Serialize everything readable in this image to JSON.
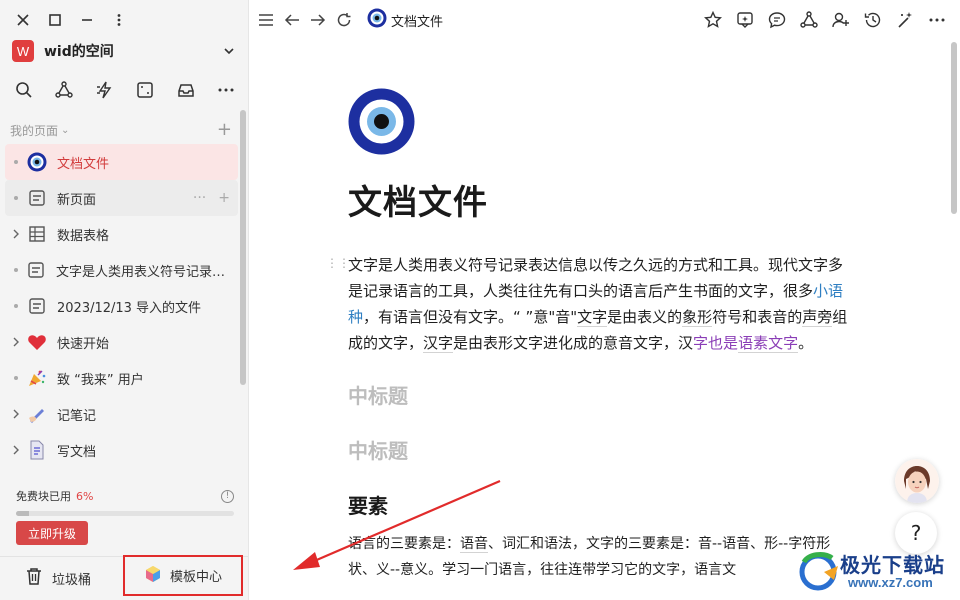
{
  "space": {
    "avatar_letter": "W",
    "name": "wid的空间"
  },
  "sidebar": {
    "section_label": "我的页面",
    "items": [
      {
        "label": "文档文件",
        "icon": "evil-eye-icon"
      },
      {
        "label": "新页面",
        "icon": "page-icon"
      },
      {
        "label": "数据表格",
        "icon": "table-icon"
      },
      {
        "label": "文字是人类用表义符号记录表达信息以传之久远的方式和工具",
        "icon": "page-icon"
      },
      {
        "label": "2023/12/13 导入的文件",
        "icon": "page-icon"
      },
      {
        "label": "快速开始",
        "icon": "heart-icon"
      },
      {
        "label": "致 “我来” 用户",
        "icon": "party-popper-icon"
      },
      {
        "label": "记笔记",
        "icon": "writing-hand-icon"
      },
      {
        "label": "写文档",
        "icon": "document-icon"
      }
    ]
  },
  "quota": {
    "label": "免费块已用",
    "percent_text": "6%",
    "fraction": 0.06
  },
  "upgrade_label": "立即升级",
  "trash_label": "垃圾桶",
  "template_label": "模板中心",
  "breadcrumb": {
    "title": "文档文件"
  },
  "doc": {
    "title": "文档文件",
    "p1": {
      "t1": "文字是人类用表义符号记录表达信息以传之久远的方式和工具。现代文字多是记录语言的工具，人类往往先有口头的语言后产生书面的文字，很多",
      "l1": "小语种",
      "t2": "，有语言但没有文字。“ ”意\"音\"",
      "u1": "文字",
      "t3": "是由表义的",
      "u2": "象形",
      "t4": "符号和表音的",
      "u3": "声旁",
      "t5": "组成的文字，",
      "u4": "汉字",
      "t6": "是由表形文字进化成的意音文字，汉",
      "p1": "字也是",
      "p2": "语素文字",
      "t7": "。"
    },
    "heading1": "中标题",
    "heading2": "中标题",
    "heading3": "要素",
    "p2": {
      "t1": "语言的三要素是：",
      "u1": "语音",
      "t2": "、词汇和语法，文字的三要素是：音--语音、形--字符形状、义--意义。学习一门语言，往往连带学习它的文字，语言文"
    }
  },
  "help_label": "?",
  "watermark": {
    "title": "极光下载站",
    "url": "www.xz7.com"
  },
  "colors": {
    "accent": "#d84848",
    "highlight_box": "#e12b2b",
    "link": "#2f7fc2",
    "purple": "#8a3db6"
  }
}
